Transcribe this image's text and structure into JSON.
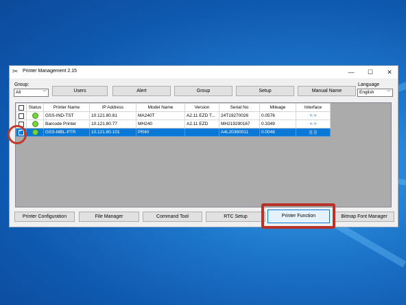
{
  "window": {
    "title": "Printer Management 2.15",
    "controls": {
      "minimize": "—",
      "maximize": "☐",
      "close": "✕"
    }
  },
  "group": {
    "label": "Group:",
    "value": "All"
  },
  "language": {
    "label": "Language",
    "value": "English"
  },
  "top_buttons": [
    "Users",
    "Alert",
    "Group",
    "Setup",
    "Manual Name"
  ],
  "table": {
    "headers": [
      "Status",
      "Printer Name",
      "IP Address",
      "Model Name",
      "Version",
      "Serial No",
      "Mileage",
      "Interface"
    ],
    "rows": [
      {
        "checked": false,
        "name": "GSS-IND-TST",
        "ip": "10.121.80.81",
        "model": "MA240T",
        "version": "A2.11 EZD T...",
        "serial": "24T19270026",
        "mileage": "0.0576",
        "interface": "<·>"
      },
      {
        "checked": false,
        "name": "Barcode Printer",
        "ip": "10.121.80.77",
        "model": "MH240",
        "version": "A2.11 EZD",
        "serial": "MH219290167",
        "mileage": "0.3349",
        "interface": "<·>"
      },
      {
        "checked": true,
        "name": "GSS-MBL-PTR",
        "ip": "10.121.80.101",
        "model": "PR40",
        "version": "",
        "serial": "A4L20360011",
        "mileage": "0.0048",
        "interface": "((·))"
      }
    ]
  },
  "bottom_buttons": [
    "Printer Configuration",
    "File Manager",
    "Command Tool",
    "RTC Setup",
    "Printer Function",
    "Bitmap Font Manager"
  ],
  "colors": {
    "selection": "#0a78d7",
    "highlight": "#b8322a",
    "desktop": "#1e78cc"
  }
}
